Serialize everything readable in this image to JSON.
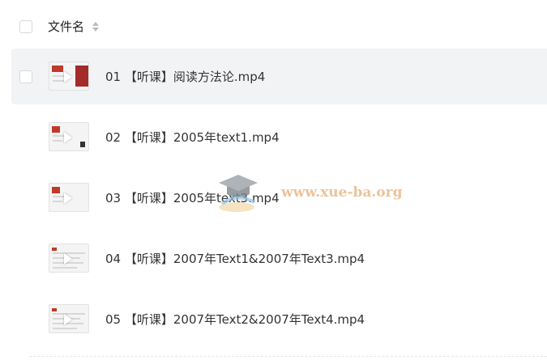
{
  "header": {
    "column_label": "文件名"
  },
  "files": [
    {
      "name": "01 【听课】阅读方法论.mp4"
    },
    {
      "name": "02 【听课】2005年text1.mp4"
    },
    {
      "name": "03 【听课】2005年text3.mp4"
    },
    {
      "name": "04 【听课】2007年Text1&2007年Text3.mp4"
    },
    {
      "name": "05 【听课】2007年Text2&2007年Text4.mp4"
    }
  ],
  "watermark": {
    "text": "www.xue-ba.org"
  },
  "colors": {
    "hover_row": "#f2f3f5",
    "watermark": "#e8b98a"
  }
}
